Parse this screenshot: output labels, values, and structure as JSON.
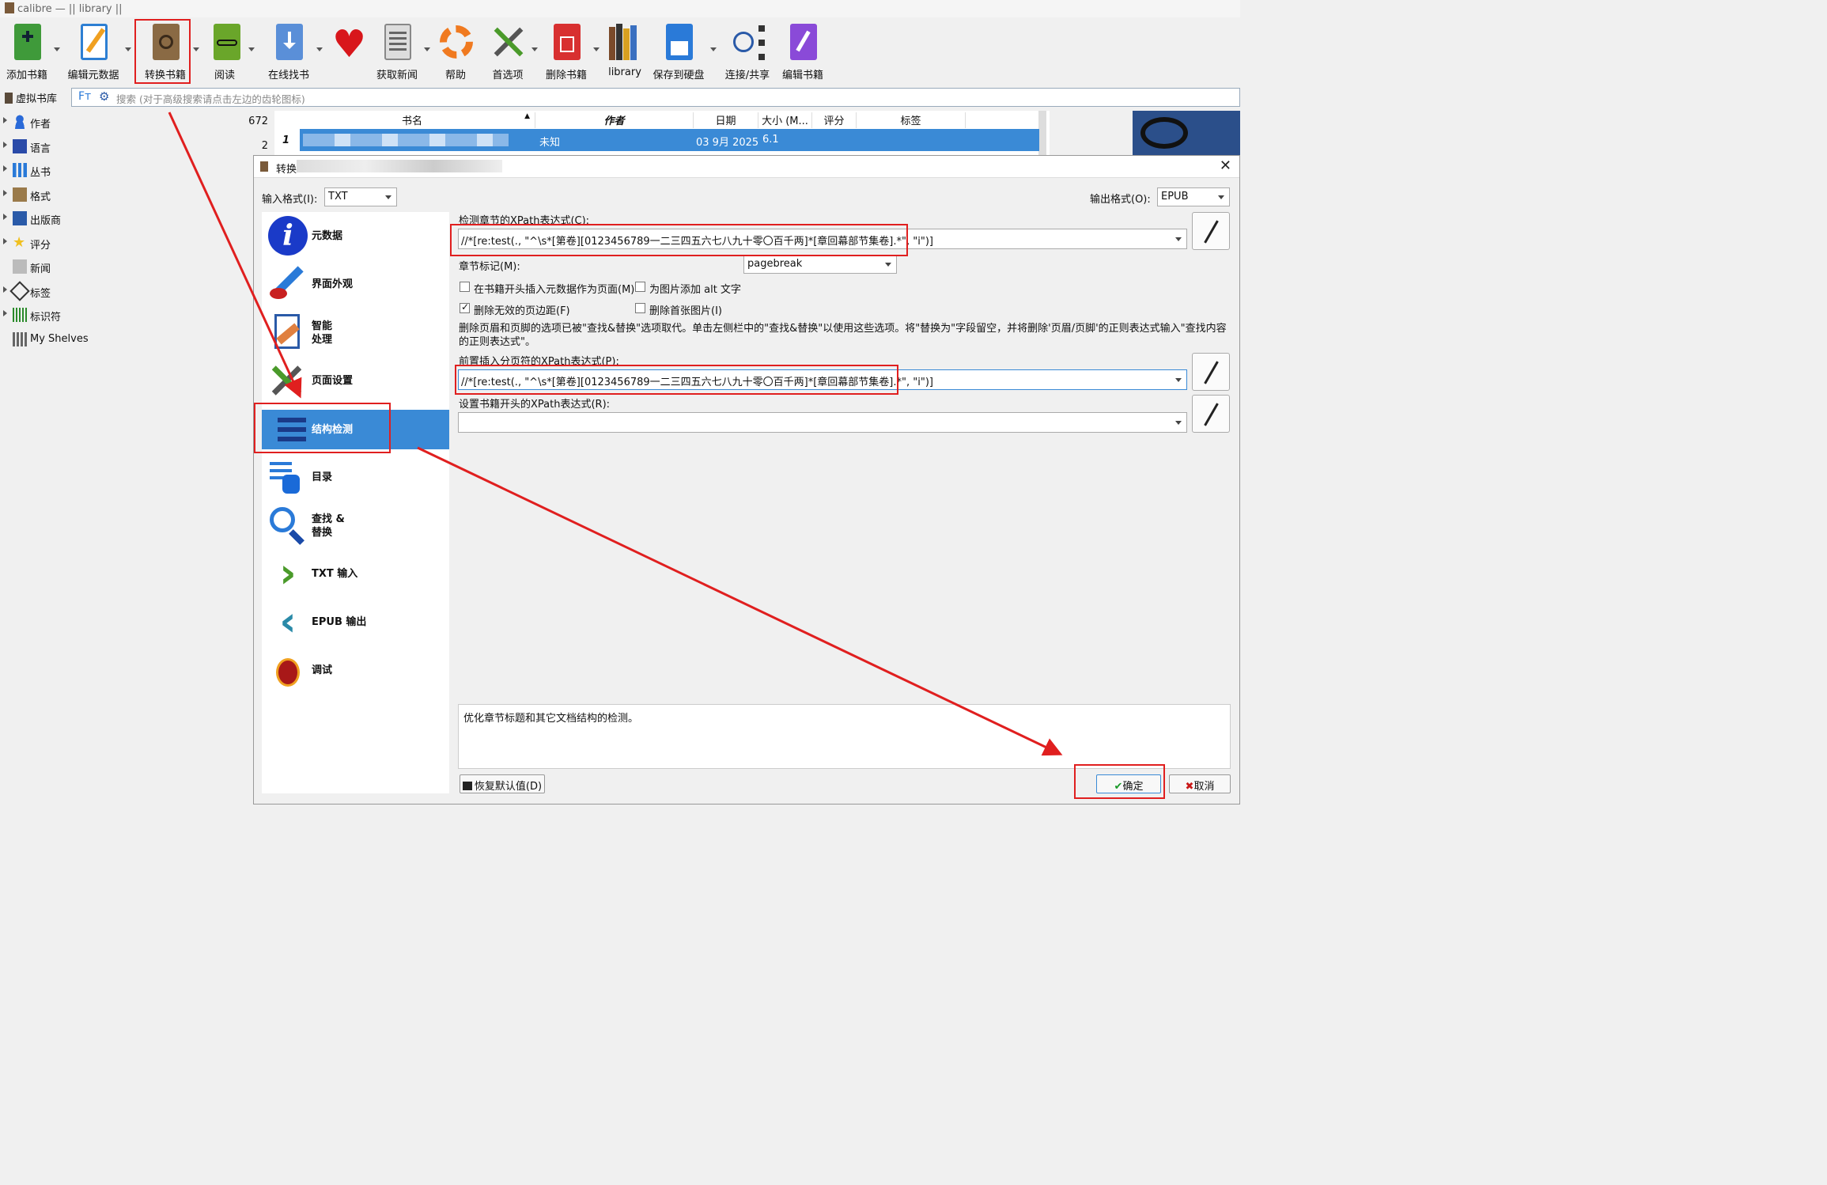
{
  "window": {
    "title": "calibre — || library ||"
  },
  "toolbar": {
    "add": "添加书籍",
    "edit_meta": "编辑元数据",
    "convert": "转换书籍",
    "read": "阅读",
    "store": "在线找书",
    "news": "获取新闻",
    "help": "帮助",
    "prefs": "首选项",
    "remove": "删除书籍",
    "library": "library",
    "save": "保存到硬盘",
    "connect": "连接/共享",
    "edit_book": "编辑书籍"
  },
  "searchbar": {
    "vlib": "虚拟书库",
    "placeholder": "搜索 (对于高级搜索请点击左边的齿轮图标)"
  },
  "tag_browser": [
    {
      "label": "作者",
      "count": "672"
    },
    {
      "label": "语言",
      "count": "2"
    },
    {
      "label": "丛书",
      "count": ""
    },
    {
      "label": "格式",
      "count": ""
    },
    {
      "label": "出版商",
      "count": ""
    },
    {
      "label": "评分",
      "count": ""
    },
    {
      "label": "新闻",
      "count": ""
    },
    {
      "label": "标签",
      "count": ""
    },
    {
      "label": "标识符",
      "count": ""
    },
    {
      "label": "My Shelves",
      "count": ""
    }
  ],
  "booklist": {
    "columns": [
      "书名",
      "作者",
      "日期",
      "大小 (M...",
      "评分",
      "标签"
    ],
    "row": {
      "num": "1",
      "author": "未知",
      "date": "03 9月 2025",
      "size": "6.1"
    }
  },
  "dialog": {
    "title": "转换",
    "input_format_label": "输入格式(I):",
    "input_format": "TXT",
    "output_format_label": "输出格式(O):",
    "output_format": "EPUB",
    "nav": [
      {
        "label": "元数据"
      },
      {
        "label": "界面外观"
      },
      {
        "label": "智能\n处理"
      },
      {
        "label": "页面设置"
      },
      {
        "label": "结构检测"
      },
      {
        "label": "目录"
      },
      {
        "label": "查找 &\n替换"
      },
      {
        "label": "TXT 输入"
      },
      {
        "label": "EPUB 输出"
      },
      {
        "label": "调试"
      }
    ],
    "chapter_xpath_label": "检测章节的XPath表达式(C):",
    "chapter_xpath": "//*[re:test(., \"^\\s*[第卷][0123456789一二三四五六七八九十零〇百千两]*[章回幕部节集卷].*\", \"i\")]",
    "chapter_mark_label": "章节标记(M):",
    "chapter_mark": "pagebreak",
    "cb_insert_meta": "在书籍开头插入元数据作为页面(M)",
    "cb_alt_text": "为图片添加 alt 文字",
    "cb_remove_margins": "删除无效的页边距(F)",
    "cb_remove_first_image": "删除首张图片(I)",
    "note": "删除页眉和页脚的选项已被\"查找&替换\"选项取代。单击左侧栏中的\"查找&替换\"以使用这些选项。将\"替换为\"字段留空，并将删除'页眉/页脚'的正则表达式输入\"查找内容的正则表达式\"。",
    "pagebreak_xpath_label": "前置插入分页符的XPath表达式(P):",
    "pagebreak_xpath": "//*[re:test(., \"^\\s*[第卷][0123456789一二三四五六七八九十零〇百千两]*[章回幕部节集卷].*\", \"i\")]",
    "start_xpath_label": "设置书籍开头的XPath表达式(R):",
    "start_xpath": "",
    "help_text": "优化章节标题和其它文档结构的检测。",
    "restore_btn": "恢复默认值(D)",
    "ok_btn": "确定",
    "cancel_btn": "取消"
  },
  "colors": {
    "accent": "#3a8ad6",
    "annotation": "#e01f1f"
  }
}
